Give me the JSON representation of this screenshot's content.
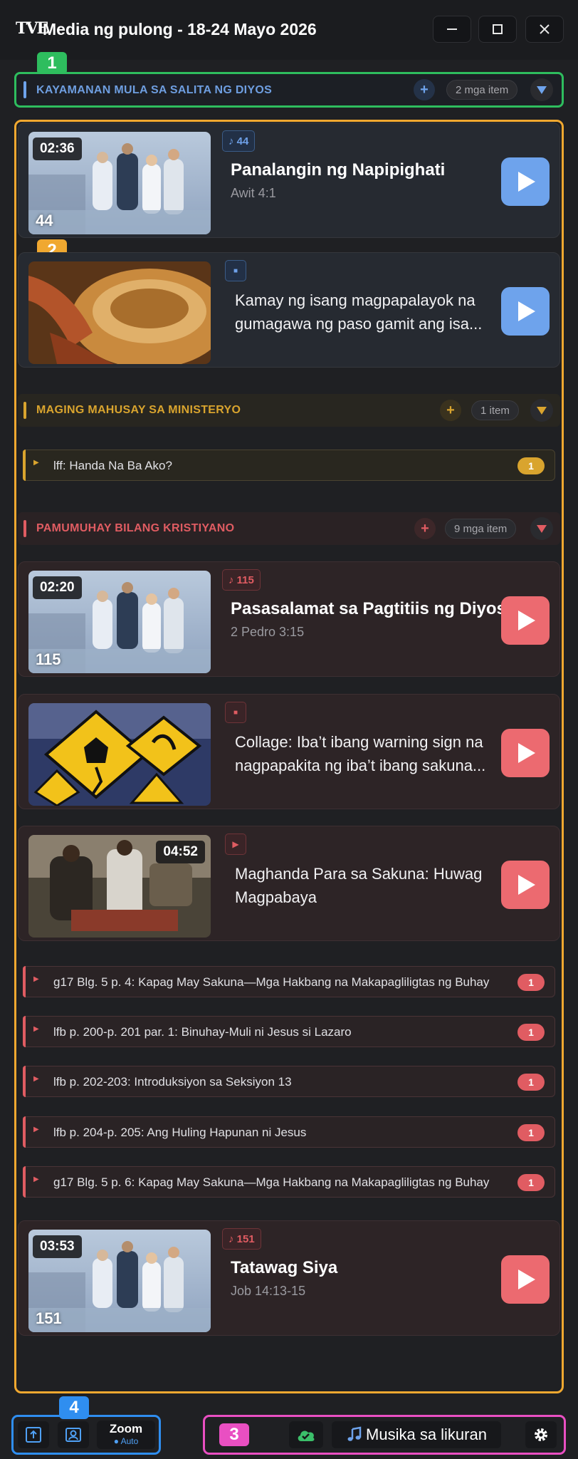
{
  "window": {
    "logo": "TVE",
    "title": "Media ng pulong - 18-24 Mayo 2026",
    "minimize_icon": "minimize-icon",
    "maximize_icon": "maximize-icon",
    "close_icon": "close-icon"
  },
  "annotations": [
    "1",
    "2",
    "3",
    "4"
  ],
  "colors": {
    "blue": "#6ea3ec",
    "gold": "#d9a42e",
    "red": "#ec6a70",
    "annot_green": "#2ebd5e",
    "annot_orange": "#f0a830",
    "annot_pink": "#e94fc2",
    "annot_blue": "#2f8ef0"
  },
  "sections": [
    {
      "title": "KAYAMANAN MULA SA SALITA NG DIYOS",
      "add": "+",
      "count": "2 mga item",
      "items": [
        {
          "type": "song",
          "duration": "02:36",
          "thumb_number": "44",
          "tag": "♪ 44",
          "title": "Panalangin ng Napipighati",
          "subtitle": "Awit 4:1"
        },
        {
          "type": "image",
          "tag": "■",
          "description": "Kamay ng isang magpapalayok na gumagawa ng paso gamit ang isa..."
        }
      ]
    },
    {
      "title": "MAGING MAHUSAY SA MINISTERYO",
      "add": "+",
      "count": "1 item",
      "rows": [
        {
          "label": "lff: Handa Na Ba Ako?",
          "count": "1"
        }
      ]
    },
    {
      "title": "PAMUMUHAY BILANG KRISTIYANO",
      "add": "+",
      "count": "9 mga item",
      "items": [
        {
          "type": "song",
          "duration": "02:20",
          "thumb_number": "115",
          "tag": "♪ 115",
          "title": "Pasasalamat sa Pagtitiis ng Diyos",
          "subtitle": "2 Pedro 3:15"
        },
        {
          "type": "image",
          "tag": "■",
          "description": "Collage: Iba’t ibang warning sign na nagpapakita ng iba’t ibang sakuna..."
        },
        {
          "type": "video",
          "duration": "04:52",
          "tag": "▶",
          "description": "Maghanda Para sa Sakuna: Huwag Magpabaya"
        }
      ],
      "rows": [
        {
          "label": "g17 Blg. 5 p. 4: Kapag May Sakuna—Mga Hakbang na Makapagliligtas ng Buhay",
          "count": "1"
        },
        {
          "label": "lfb p. 200-p. 201 par. 1: Binuhay-Muli ni Jesus si Lazaro",
          "count": "1"
        },
        {
          "label": "lfb p. 202-203: Introduksiyon sa Seksiyon 13",
          "count": "1"
        },
        {
          "label": "lfb p. 204-p. 205: Ang Huling Hapunan ni Jesus",
          "count": "1"
        },
        {
          "label": "g17 Blg. 5 p. 6: Kapag May Sakuna—Mga Hakbang na Makapagliligtas ng Buhay",
          "count": "1"
        }
      ],
      "last_item": {
        "type": "song",
        "duration": "03:53",
        "thumb_number": "151",
        "tag": "♪ 151",
        "title": "Tatawag Siya",
        "subtitle": "Job 14:13-15"
      }
    }
  ],
  "footer": {
    "upload_icon": "upload-icon",
    "camera_icon": "presenter-camera-icon",
    "zoom_label": "Zoom",
    "zoom_status": "● Auto",
    "cloud_icon": "cloud-check-icon",
    "music_icon": "music-note-icon",
    "music_label": "Musika sa likuran",
    "settings_icon": "gear-icon"
  }
}
